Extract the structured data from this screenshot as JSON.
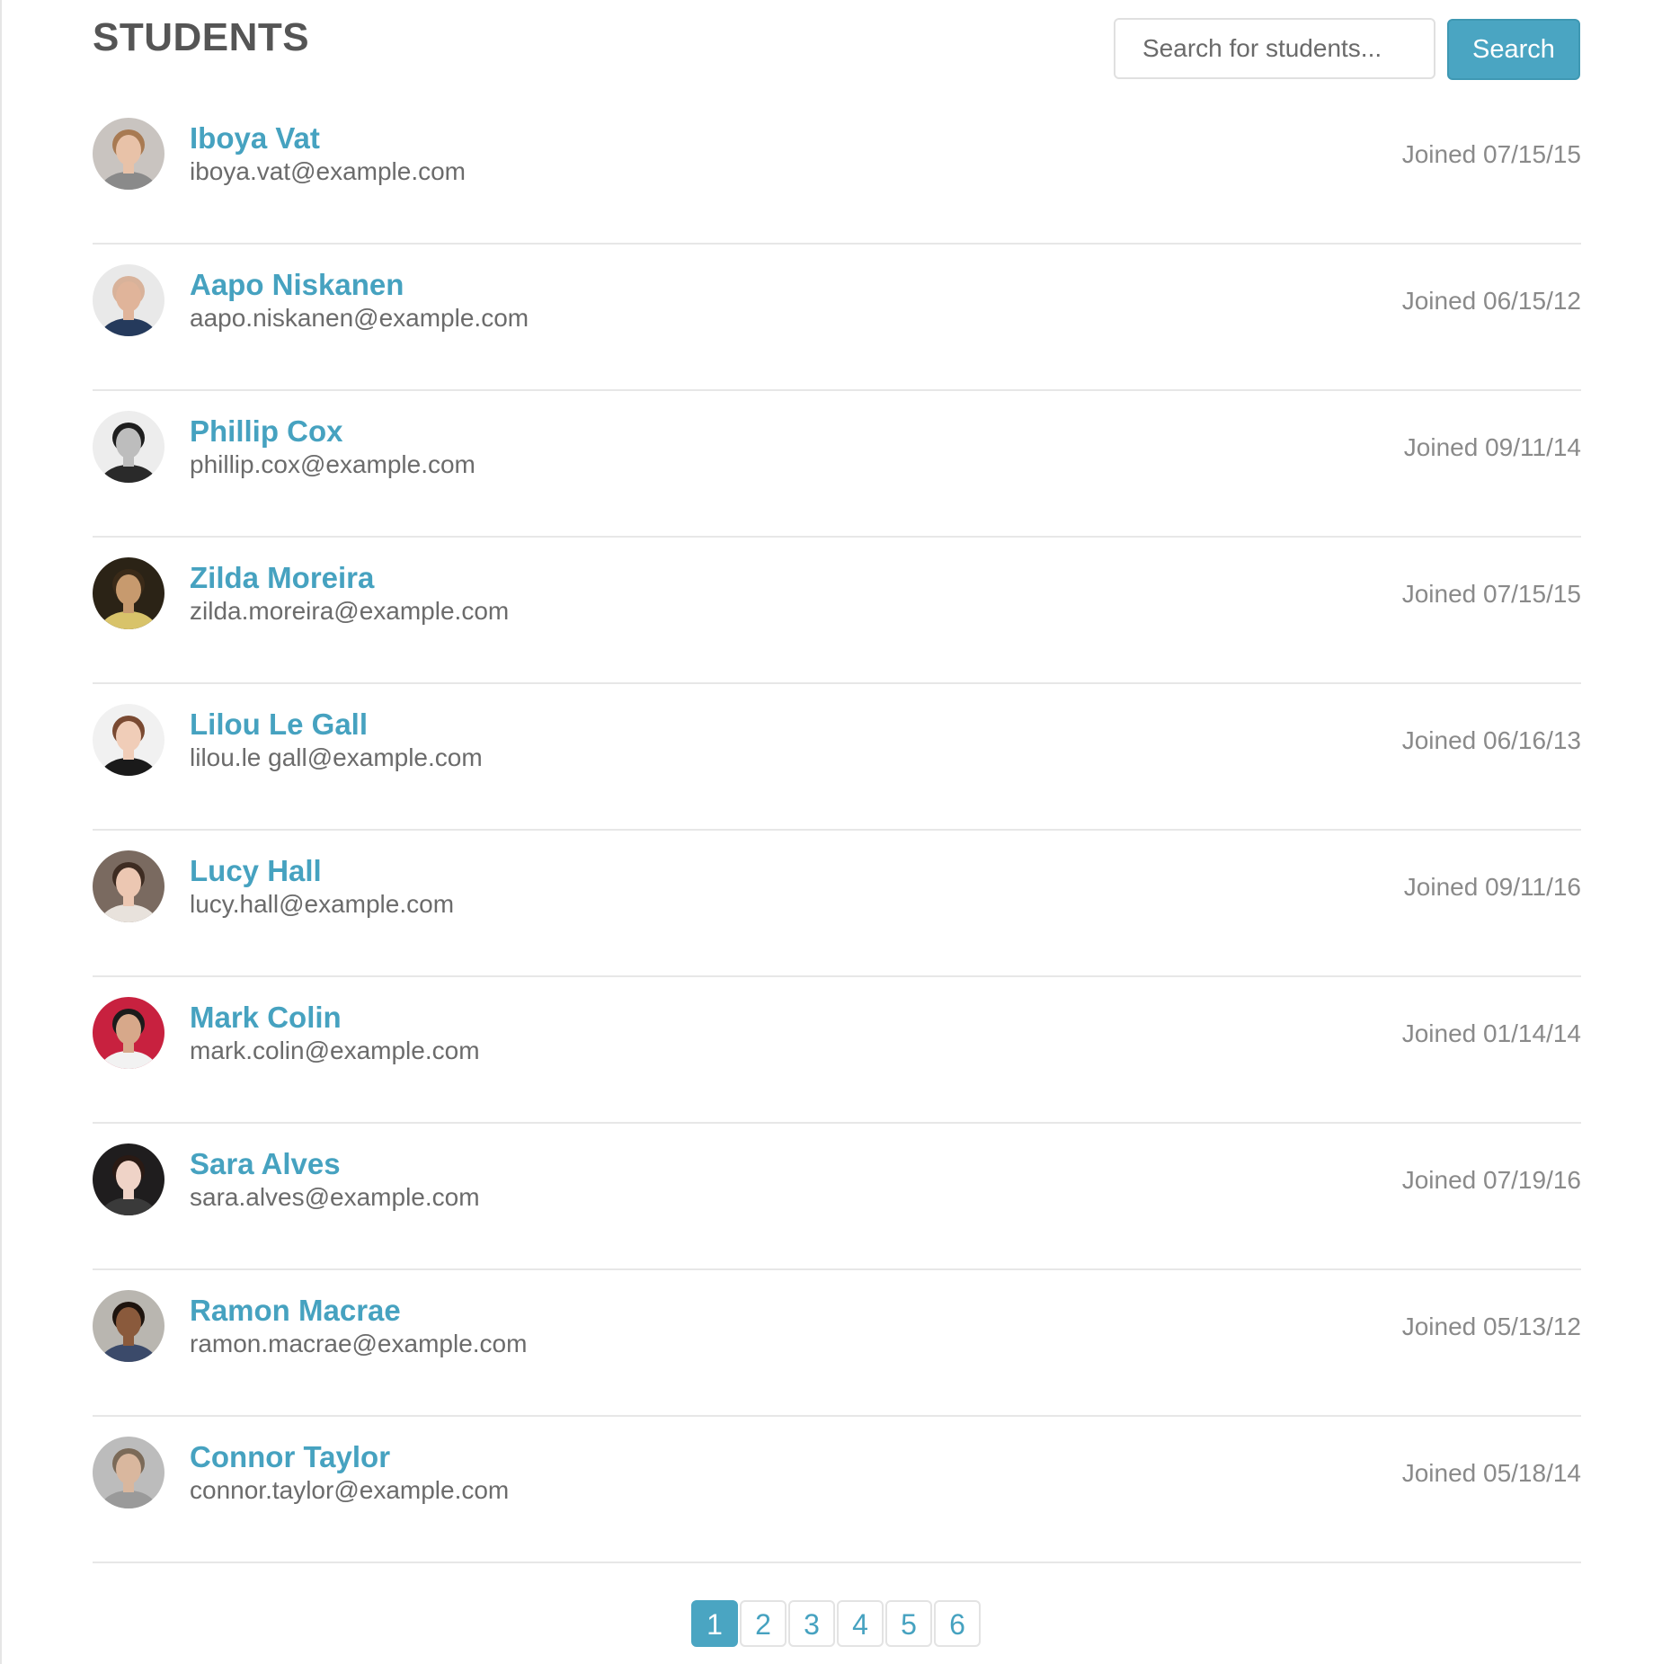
{
  "header": {
    "title": "STUDENTS",
    "search_placeholder": "Search for students...",
    "search_button_label": "Search"
  },
  "students": [
    {
      "name": "Iboya Vat",
      "email": "iboya.vat@example.com",
      "joined": "Joined 07/15/15"
    },
    {
      "name": "Aapo Niskanen",
      "email": "aapo.niskanen@example.com",
      "joined": "Joined 06/15/12"
    },
    {
      "name": "Phillip Cox",
      "email": "phillip.cox@example.com",
      "joined": "Joined 09/11/14"
    },
    {
      "name": "Zilda Moreira",
      "email": "zilda.moreira@example.com",
      "joined": "Joined 07/15/15"
    },
    {
      "name": "Lilou Le Gall",
      "email": "lilou.le gall@example.com",
      "joined": "Joined 06/16/13"
    },
    {
      "name": "Lucy Hall",
      "email": "lucy.hall@example.com",
      "joined": "Joined 09/11/16"
    },
    {
      "name": "Mark Colin",
      "email": "mark.colin@example.com",
      "joined": "Joined 01/14/14"
    },
    {
      "name": "Sara Alves",
      "email": "sara.alves@example.com",
      "joined": "Joined 07/19/16"
    },
    {
      "name": "Ramon Macrae",
      "email": "ramon.macrae@example.com",
      "joined": "Joined 05/13/12"
    },
    {
      "name": "Connor Taylor",
      "email": "connor.taylor@example.com",
      "joined": "Joined 05/18/14"
    }
  ],
  "pagination": {
    "pages": [
      "1",
      "2",
      "3",
      "4",
      "5",
      "6"
    ],
    "current": "1"
  },
  "colors": {
    "accent": "#4aa5c2",
    "name_link": "#46a2c0",
    "title": "#555555",
    "date": "#8a8a8a"
  },
  "icons": {
    "avatar": "avatar-photo"
  }
}
